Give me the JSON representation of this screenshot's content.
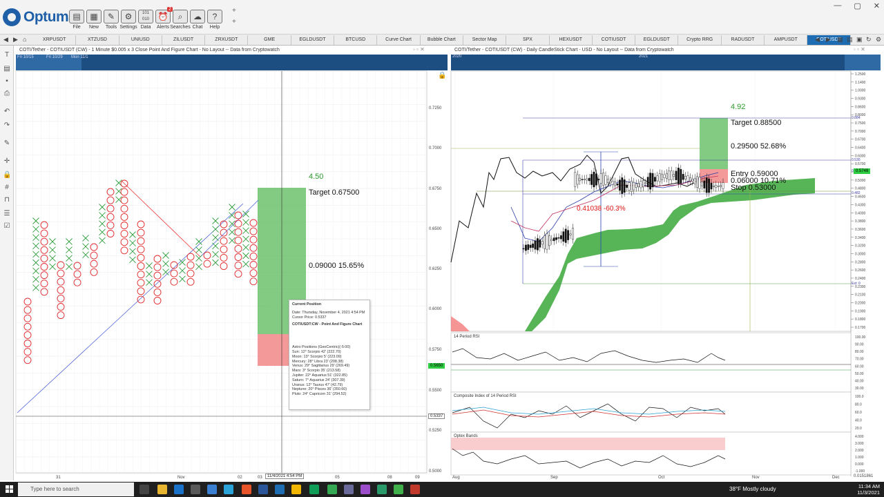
{
  "app": {
    "name": "Optuma"
  },
  "toolbar": {
    "buttons": [
      {
        "label": "File",
        "icon": "folder-icon"
      },
      {
        "label": "New",
        "icon": "new-grid-icon"
      },
      {
        "label": "Tools",
        "icon": "tools-icon"
      },
      {
        "label": "Settings",
        "icon": "gear-icon"
      },
      {
        "label": "Data",
        "icon": "binary-data-icon"
      },
      {
        "label": "Alerts",
        "icon": "alarm-clock-icon",
        "badge": "2"
      },
      {
        "label": "Searches",
        "icon": "magnifier-icon"
      },
      {
        "label": "Chat",
        "icon": "chat-icon"
      },
      {
        "label": "Help",
        "icon": "question-icon"
      }
    ]
  },
  "tabs": [
    "XRPUSDT",
    "XTZUSD",
    "UNIUSD",
    "ZILUSDT",
    "ZRXUSDT",
    "GME",
    "EGLDUSDT",
    "BTCUSD",
    "Curve Chart",
    "Bubble Chart",
    "Sector Map",
    "SPX",
    "HEXUSDT",
    "COTIUSDT",
    "EGLDUSDT",
    "Crypto RRG",
    "RADUSDT",
    "AMPUSDT",
    "COTIUSDT"
  ],
  "active_tab": 18,
  "left_chart": {
    "title": "COTI/Tether - COTIUSDT (CW) - 1 Minute $0.005 x 3 Close Point And Figure Chart - No Layout -- Data from Cryptowatch",
    "nav_labels": [
      "Fri 10/15",
      "Fri 10/29",
      "Mon 11/1"
    ],
    "y_ticks": [
      "0.7250",
      "0.7000",
      "0.6750",
      "0.6500",
      "0.6250",
      "0.6000",
      "0.5750",
      "0.5500",
      "0.5250",
      "0.5000"
    ],
    "x_ticks": [
      "31",
      "Nov",
      "02",
      "03",
      "05",
      "08",
      "09"
    ],
    "cursor_date": "11/4/2021 4:54 PM",
    "cursor_price": "0.5337",
    "last_price": "0.5650",
    "target_move": "4.50",
    "target_label": "Target  0.67500",
    "gain_label": "0.09000  15.65%"
  },
  "tooltip": {
    "heading": "Current Position",
    "date": "Date: Thursday, November 4, 2021 4:54 PM",
    "cursor": "Cursor Price: 0.5337",
    "chart": "COTIUSDT:CW - Point And Figure Chart",
    "astro_heading": "Astro Positions (GeoCentric)(-5:00)",
    "astro": [
      "Sun: 12° Scorpio 42' (222.70)",
      "Moon: 13° Scorpio 5' (223.09)",
      "Mercury: 28° Libra 23' (208.38)",
      "Venus: 29° Sagittarius 29' (269.49)",
      "Mars: 3° Scorpio 35' (213.58)",
      "Jupiter: 22° Aquarius 51' (322.85)",
      "Saturn: 7° Aquarius 24' (307.39)",
      "Uranus: 12° Taurus 47' (42.79)",
      "Neptune: 20° Pisces 36' (350.60)",
      "Pluto: 24° Capricorn 31' (294.52)"
    ]
  },
  "right_chart": {
    "title": "COTI/Tether - COTIUSDT (CW) - Daily CandleStick Chart - USD - No Layout -- Data from Cryptowatch",
    "nav_labels": [
      "2020",
      "2021"
    ],
    "y_ticks": [
      "1.2500",
      "1.1400",
      "1.0000",
      "0.9300",
      "0.8600",
      "0.8000",
      "0.7500",
      "0.7000",
      "0.6700",
      "0.6400",
      "0.6000",
      "0.5700",
      "0.5400",
      "0.5000",
      "0.4800",
      "0.4600",
      "0.4300",
      "0.4000",
      "0.3800",
      "0.3600",
      "0.3400",
      "0.3200",
      "0.3000",
      "0.2800",
      "0.2600",
      "0.2400",
      "0.2300",
      "0.2100",
      "0.2000",
      "0.1900",
      "0.1800",
      "0.1700"
    ],
    "x_ticks": [
      "Aug",
      "Sep",
      "Oct",
      "Nov",
      "Dec"
    ],
    "level_labels": [
      "0.884",
      "0.530",
      "0.590",
      "0.482",
      "Ext: 0"
    ],
    "last_price": "0.5748",
    "move": "4.92",
    "target": "Target  0.88500",
    "gain": "0.29500  52.68%",
    "entry": "Entry  0.59000",
    "risk": "0.06000  10.71%",
    "stop": "Stop  0.53000",
    "drawdown": "0.41038  -60.3%",
    "bottom_value": "0.0151861"
  },
  "rsi_panel": {
    "title": "14 Period RSI",
    "ticks": [
      "100.00",
      "90.00",
      "80.00",
      "70.00",
      "60.00",
      "50.00",
      "40.00",
      "30.00"
    ]
  },
  "ci_panel": {
    "title": "Composite Index of 14 Period RSI",
    "ticks": [
      "100.0",
      "80.0",
      "60.0",
      "40.0",
      "20.0"
    ]
  },
  "optex_panel": {
    "title": "Optex Bands",
    "ticks": [
      "4.000",
      "3.000",
      "2.000",
      "1.000",
      "0.000",
      "-1.000"
    ]
  },
  "taskbar": {
    "search_placeholder": "Type here to search",
    "weather": "38°F  Mostly cloudy",
    "time": "11:34 AM",
    "date": "11/3/2021"
  },
  "colors": {
    "accent": "#1e6db3",
    "x_mark": "#2e9e3e",
    "o_mark": "#e0272b",
    "target_box": "#5ab85a",
    "stop_box": "#f07f7f",
    "cloud": "#3aa83a"
  }
}
